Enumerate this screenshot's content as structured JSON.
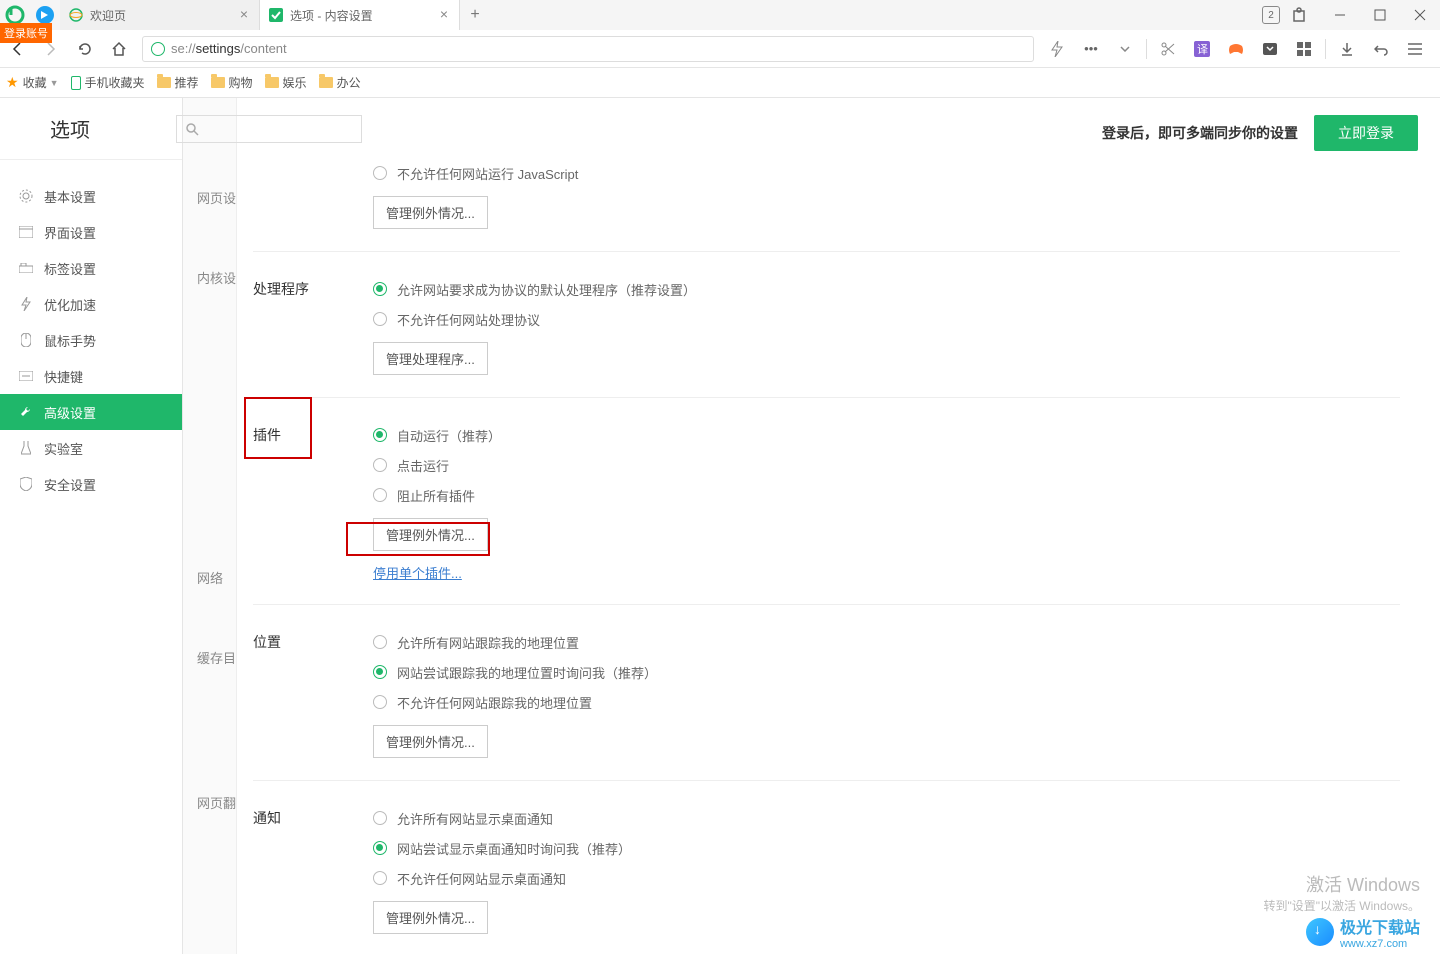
{
  "titlebar": {
    "tabs": [
      {
        "icon_color": "#1fb76a",
        "title": "欢迎页"
      },
      {
        "icon_color": "#1fb76a",
        "title": "选项 - 内容设置"
      }
    ],
    "badge_count": "2",
    "login_badge": "登录账号"
  },
  "toolbar": {
    "url_prefix": "se://",
    "url_mid": "settings",
    "url_suffix": "/content"
  },
  "bookmarks": {
    "fav": "收藏",
    "items": [
      "手机收藏夹",
      "推荐",
      "购物",
      "娱乐",
      "办公"
    ]
  },
  "header": {
    "title": "选项",
    "search_placeholder": "",
    "sync_text": "登录后，即可多端同步你的设置",
    "login_btn": "立即登录"
  },
  "sidebar": {
    "items": [
      "基本设置",
      "界面设置",
      "标签设置",
      "优化加速",
      "鼠标手势",
      "快捷键",
      "高级设置",
      "实验室",
      "安全设置"
    ],
    "active_index": 6
  },
  "sub_sidebar": {
    "items": [
      "网页设",
      "内核设",
      "网络",
      "缓存目",
      "网页翻"
    ]
  },
  "sections": {
    "js": {
      "opt1": "不允许任何网站运行 JavaScript",
      "btn": "管理例外情况..."
    },
    "handler": {
      "title": "处理程序",
      "opt1": "允许网站要求成为协议的默认处理程序（推荐设置）",
      "opt2": "不允许任何网站处理协议",
      "btn": "管理处理程序..."
    },
    "plugins": {
      "title": "插件",
      "opt1": "自动运行（推荐）",
      "opt2": "点击运行",
      "opt3": "阻止所有插件",
      "btn": "管理例外情况...",
      "link": "停用单个插件..."
    },
    "location": {
      "title": "位置",
      "opt1": "允许所有网站跟踪我的地理位置",
      "opt2": "网站尝试跟踪我的地理位置时询问我（推荐）",
      "opt3": "不允许任何网站跟踪我的地理位置",
      "btn": "管理例外情况..."
    },
    "notify": {
      "title": "通知",
      "opt1": "允许所有网站显示桌面通知",
      "opt2": "网站尝试显示桌面通知时询问我（推荐）",
      "opt3": "不允许任何网站显示桌面通知",
      "btn": "管理例外情况..."
    }
  },
  "watermark": {
    "line1": "激活 Windows",
    "line2": "转到\"设置\"以激活 Windows。",
    "logo_text": "极光下载站",
    "logo_sub": "www.xz7.com"
  }
}
